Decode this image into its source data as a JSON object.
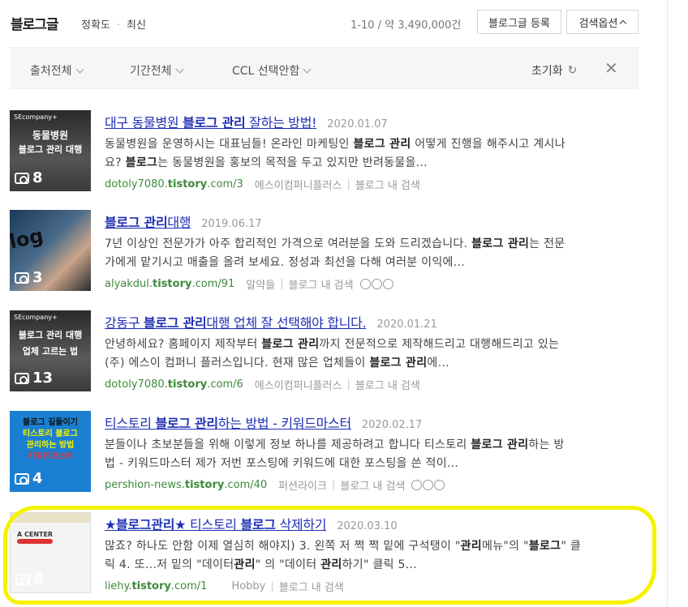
{
  "header": {
    "title": "블로그글",
    "sort": [
      "정확도",
      "최신"
    ],
    "count": "1-10 / 약 3,490,000건",
    "register_label": "블로그글 등록",
    "options_label": "검색옵션"
  },
  "filters": {
    "source": "출처전체",
    "period": "기간전체",
    "ccl": "CCL 선택안함",
    "reset": "초기화"
  },
  "results": [
    {
      "title_parts": [
        "대구 동물병원 ",
        "블로그 관리",
        " 잘하는 방법!"
      ],
      "date": "2020.01.07",
      "desc_line1": [
        "동물병원을 운영하시는 대표님들! 온라인 마케팅인 ",
        "블로그 관리",
        " 어떻게 진행을 해주시고 계시나"
      ],
      "desc_line2": [
        "요? ",
        "블로그",
        "는 동물병원을 홍보의 목적을 두고 있지만 반려동물을..."
      ],
      "url_pre": "dotoly7080.",
      "url_host": "tistory",
      "url_post": ".com/3",
      "blog": "에스이컴퍼니플러스",
      "search_in": "블로그 내 검색",
      "image_count": "8",
      "thumb_brand": "SEcompany+",
      "thumb_lines": [
        "동물병원",
        "블로그 관리 대행"
      ]
    },
    {
      "title_parts": [
        "",
        "블로그 관리",
        "대행"
      ],
      "date": "2019.06.17",
      "desc_line1": [
        "7년 이상인 전문가가 아주 합리적인 가격으로 여러분을 도와 드리겠습니다. ",
        "블로그 관리",
        "는 전문"
      ],
      "desc_line2": [
        "가에게 맡기시고 매출을 올려 보세요. 정성과 최선을 다해 여러분 이익에...",
        "",
        ""
      ],
      "url_pre": "alyakdul.",
      "url_host": "tistory",
      "url_post": ".com/91",
      "blog": "알약들",
      "search_in": "블로그 내 검색",
      "image_count": "3",
      "thumb_brand": "",
      "thumb_lines": [
        "blog",
        ""
      ]
    },
    {
      "title_parts": [
        "강동구 ",
        "블로그 관리",
        "대행 업체 잘 선택해야 합니다."
      ],
      "date": "2020.01.21",
      "desc_line1": [
        "안녕하세요? 홈페이지 제작부터 ",
        "블로그 관리",
        "까지 전문적으로 제작해드리고 대행해드리고 있는"
      ],
      "desc_line2": [
        "(주) 에스이 컴퍼니 플러스입니다. 현재 많은 업체들이 ",
        "블로그 관리",
        "에..."
      ],
      "url_pre": "dotoly7080.",
      "url_host": "tistory",
      "url_post": ".com/6",
      "blog": "에스이컴퍼니플러스",
      "search_in": "블로그 내 검색",
      "image_count": "13",
      "thumb_brand": "SEcompany+",
      "thumb_lines": [
        "블로그 관리 대행",
        "업체 고르는 법"
      ]
    },
    {
      "title_parts": [
        "티스토리 ",
        "블로그 관리",
        "하는 방법 - 키워드마스터"
      ],
      "date": "2020.02.17",
      "desc_line1": [
        "분들이나 초보분들을 위해 이렇게 정보 하나를 제공하려고 합니다 티스토리 ",
        "블로그 관리",
        "하는 방"
      ],
      "desc_line2": [
        "법 - 키워드마스터 제가 저번 포스팅에 키워드에 대한 포스팅을 쓴 적이...",
        "",
        ""
      ],
      "url_pre": "pershion-news.",
      "url_host": "tistory",
      "url_post": ".com/40",
      "blog": "퍼션라이크",
      "search_in": "블로그 내 검색",
      "image_count": "4",
      "thumb_brand": "",
      "thumb_lines": [
        "블로그 길들이기",
        "티스토리 블로그",
        "관리하는 방법",
        "키워드마스터"
      ]
    },
    {
      "title_parts": [
        "★",
        "블로그관리",
        "★ 티스토리 ",
        "블로그",
        " 삭제하기"
      ],
      "date": "2020.03.10",
      "desc_line1": [
        "많죠? 하나도 안함 이제 열심히 해야지) 3. 왼쪽 저 쩍 쩍 밑에 구석탱이 \"",
        "관리",
        "메뉴\"의 \"",
        "블로그",
        "\" 클"
      ],
      "desc_line2": [
        "릭 4. 또...저 밑의 \"데이터",
        "관리",
        "\" 의 \"데이터 ",
        "관리",
        "하기\" 클릭 5..."
      ],
      "url_pre": "liehy.",
      "url_host": "tistory",
      "url_post": ".com/1",
      "blog": "Hobby",
      "search_in": "블로그 내 검색",
      "image_count": "8",
      "thumb_brand": "",
      "thumb_lines": [
        "A CENTER"
      ]
    }
  ]
}
